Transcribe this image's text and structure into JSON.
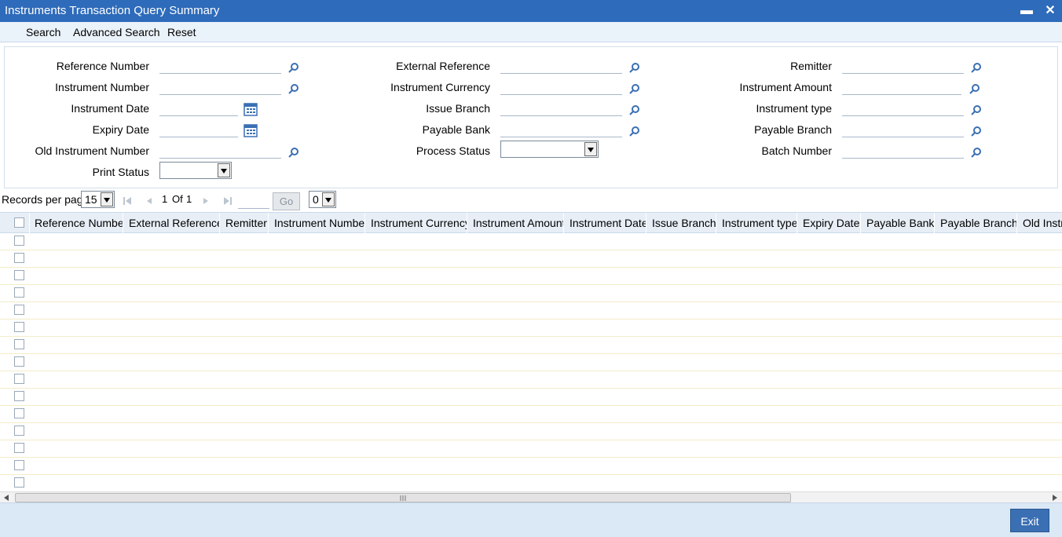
{
  "window": {
    "title": "Instruments Transaction Query Summary",
    "minimize_glyph": "▬",
    "close_glyph": "✕"
  },
  "toolbar": {
    "search_label": "Search",
    "advanced_search_label": "Advanced Search",
    "reset_label": "Reset"
  },
  "criteria": {
    "reference_number": "Reference Number",
    "instrument_number": "Instrument Number",
    "instrument_date": "Instrument Date",
    "expiry_date": "Expiry Date",
    "old_instrument_number": "Old Instrument Number",
    "print_status": "Print Status",
    "external_reference": "External Reference",
    "instrument_currency": "Instrument Currency",
    "issue_branch": "Issue Branch",
    "payable_bank": "Payable Bank",
    "process_status": "Process Status",
    "remitter": "Remitter",
    "instrument_amount": "Instrument Amount",
    "instrument_type": "Instrument type",
    "payable_branch": "Payable Branch",
    "batch_number": "Batch Number",
    "print_status_value": "",
    "process_status_value": ""
  },
  "pager": {
    "records_per_page_label": "Records per page",
    "records_per_page_value": "15",
    "page_current": "1",
    "page_of": "Of",
    "page_total": "1",
    "go_label": "Go",
    "extra_select_value": "0"
  },
  "grid": {
    "columns": [
      "Reference Number",
      "External Reference",
      "Remitter",
      "Instrument Number",
      "Instrument Currency",
      "Instrument Amount",
      "Instrument Date",
      "Issue Branch",
      "Instrument type",
      "Expiry Date",
      "Payable Bank",
      "Payable Branch",
      "Old Instrument Number"
    ],
    "row_count": 15
  },
  "footer": {
    "exit_label": "Exit"
  },
  "colors": {
    "titlebar": "#2e6bba",
    "toolbar": "#eaf2fa",
    "header": "#e7eef6",
    "footer": "#dbe8f5",
    "accent": "#3a6fb3"
  },
  "icons": {
    "lookup": "magnifier-icon",
    "calendar": "calendar-icon",
    "first_page": "first-page-icon",
    "prev_page": "prev-page-icon",
    "next_page": "next-page-icon",
    "last_page": "last-page-icon"
  }
}
